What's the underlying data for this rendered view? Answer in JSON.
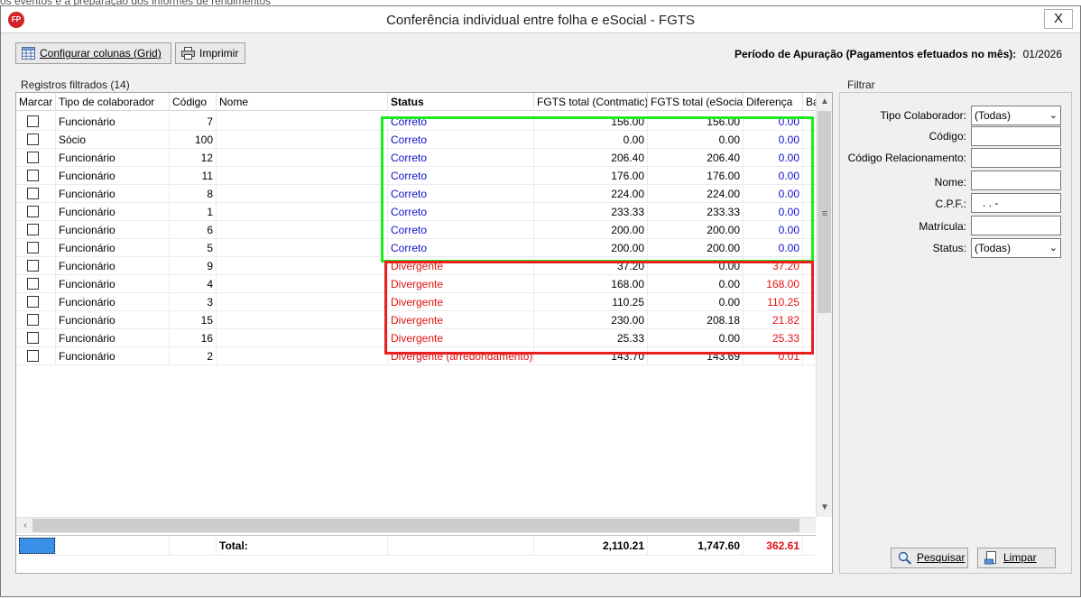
{
  "background": {
    "partial_text": "os eventos e a preparação dos informes de rendimentos"
  },
  "window": {
    "title": "Conferência individual entre folha e eSocial - FGTS",
    "close_label": "X",
    "app_icon_text": "FP"
  },
  "toolbar": {
    "configure_columns_label": "Configurar colunas (Grid)",
    "print_label": "Imprimir"
  },
  "period": {
    "label": "Período de Apuração (Pagamentos efetuados no mês):",
    "value": "01/2026"
  },
  "grid": {
    "group_label": "Registros filtrados (14)",
    "columns": [
      "Marcar",
      "Tipo de colaborador",
      "Código",
      "Nome",
      "Status",
      "FGTS total (Contmatic)",
      "FGTS total (eSocial)",
      "Diferença",
      "Ba"
    ],
    "rows": [
      {
        "tipo": "Funcionário",
        "codigo": "7",
        "nome": "",
        "status": "Correto",
        "contmatic": "156.00",
        "esocial": "156.00",
        "diferenca": "0.00"
      },
      {
        "tipo": "Sócio",
        "codigo": "100",
        "nome": "",
        "status": "Correto",
        "contmatic": "0.00",
        "esocial": "0.00",
        "diferenca": "0.00"
      },
      {
        "tipo": "Funcionário",
        "codigo": "12",
        "nome": "",
        "status": "Correto",
        "contmatic": "206.40",
        "esocial": "206.40",
        "diferenca": "0.00"
      },
      {
        "tipo": "Funcionário",
        "codigo": "11",
        "nome": "",
        "status": "Correto",
        "contmatic": "176.00",
        "esocial": "176.00",
        "diferenca": "0.00"
      },
      {
        "tipo": "Funcionário",
        "codigo": "8",
        "nome": "",
        "status": "Correto",
        "contmatic": "224.00",
        "esocial": "224.00",
        "diferenca": "0.00"
      },
      {
        "tipo": "Funcionário",
        "codigo": "1",
        "nome": "",
        "status": "Correto",
        "contmatic": "233.33",
        "esocial": "233.33",
        "diferenca": "0.00"
      },
      {
        "tipo": "Funcionário",
        "codigo": "6",
        "nome": "",
        "status": "Correto",
        "contmatic": "200.00",
        "esocial": "200.00",
        "diferenca": "0.00"
      },
      {
        "tipo": "Funcionário",
        "codigo": "5",
        "nome": "",
        "status": "Correto",
        "contmatic": "200.00",
        "esocial": "200.00",
        "diferenca": "0.00"
      },
      {
        "tipo": "Funcionário",
        "codigo": "9",
        "nome": "",
        "status": "Divergente",
        "contmatic": "37.20",
        "esocial": "0.00",
        "diferenca": "37.20"
      },
      {
        "tipo": "Funcionário",
        "codigo": "4",
        "nome": "",
        "status": "Divergente",
        "contmatic": "168.00",
        "esocial": "0.00",
        "diferenca": "168.00"
      },
      {
        "tipo": "Funcionário",
        "codigo": "3",
        "nome": "",
        "status": "Divergente",
        "contmatic": "110.25",
        "esocial": "0.00",
        "diferenca": "110.25"
      },
      {
        "tipo": "Funcionário",
        "codigo": "15",
        "nome": "",
        "status": "Divergente",
        "contmatic": "230.00",
        "esocial": "208.18",
        "diferenca": "21.82"
      },
      {
        "tipo": "Funcionário",
        "codigo": "16",
        "nome": "",
        "status": "Divergente",
        "contmatic": "25.33",
        "esocial": "0.00",
        "diferenca": "25.33"
      },
      {
        "tipo": "Funcionário",
        "codigo": "2",
        "nome": "",
        "status": "Divergente (arredondamento)",
        "contmatic": "143.70",
        "esocial": "143.69",
        "diferenca": "0.01"
      }
    ],
    "total": {
      "label": "Total:",
      "contmatic": "2,110.21",
      "esocial": "1,747.60",
      "diferenca": "362.61"
    }
  },
  "filter": {
    "group_label": "Filtrar",
    "tipo_colaborador": {
      "label": "Tipo Colaborador:",
      "value": "(Todas)"
    },
    "codigo": {
      "label": "Código:",
      "value": ""
    },
    "codigo_relacionamento": {
      "label": "Código Relacionamento:",
      "value": ""
    },
    "nome": {
      "label": "Nome:",
      "value": ""
    },
    "cpf": {
      "label": "C.P.F.:",
      "value": ".   .   -"
    },
    "matricula": {
      "label": "Matrícula:",
      "value": ""
    },
    "status": {
      "label": "Status:",
      "value": "(Todas)"
    },
    "search_label": "Pesquisar",
    "clear_label": "Limpar"
  },
  "colors": {
    "correct": "#1010c8",
    "divergent": "#e01010",
    "green_highlight": "#1aee1a",
    "red_highlight": "#e82020",
    "selection": "#3b8fe8"
  }
}
